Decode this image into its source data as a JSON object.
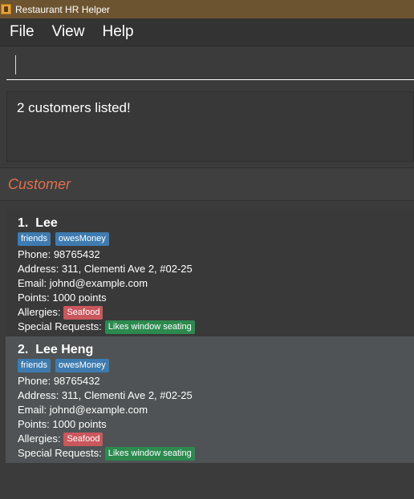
{
  "window": {
    "title": "Restaurant HR Helper"
  },
  "menu": {
    "items": [
      "File",
      "View",
      "Help"
    ]
  },
  "command": {
    "value": "",
    "placeholder": ""
  },
  "result": {
    "text": "2 customers listed!"
  },
  "section": {
    "title": "Customer"
  },
  "colors": {
    "accent": "#e0704e",
    "tag": "#3e7bb0",
    "allergy": "#c9575d",
    "request": "#2c8a4f"
  },
  "customers": [
    {
      "index": "1.",
      "name": "Lee",
      "tags": [
        "friends",
        "owesMoney"
      ],
      "phone": "Phone: 98765432",
      "address": "Address: 311, Clementi Ave 2, #02-25",
      "email": "Email: johnd@example.com",
      "points": "Points: 1000 points",
      "allergies_label": "Allergies:",
      "allergies": [
        "Seafood"
      ],
      "requests_label": "Special Requests:",
      "requests": [
        "Likes window seating"
      ]
    },
    {
      "index": "2.",
      "name": "Lee Heng",
      "tags": [
        "friends",
        "owesMoney"
      ],
      "phone": "Phone: 98765432",
      "address": "Address: 311, Clementi Ave 2, #02-25",
      "email": "Email: johnd@example.com",
      "points": "Points: 1000 points",
      "allergies_label": "Allergies:",
      "allergies": [
        "Seafood"
      ],
      "requests_label": "Special Requests:",
      "requests": [
        "Likes window seating"
      ]
    }
  ]
}
